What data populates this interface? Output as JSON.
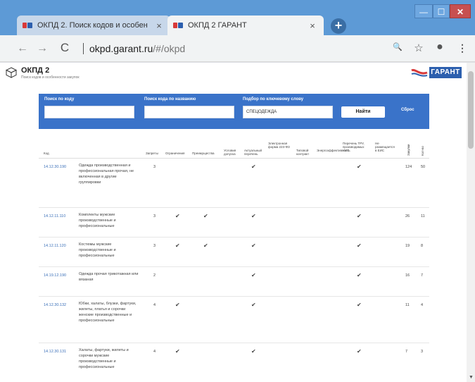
{
  "browser": {
    "tabs": [
      {
        "title": "ОКПД 2. Поиск кодов и особен",
        "close": "×"
      },
      {
        "title": "ОКПД 2 ГАРАНТ",
        "close": "×"
      }
    ],
    "new_tab": "+",
    "window_controls": {
      "minimize": "—",
      "maximize": "☐",
      "close": "✕"
    },
    "nav": {
      "back": "←",
      "forward": "→",
      "reload": "C"
    },
    "url_host": "okpd.garant.ru",
    "url_path": "/#/okpd",
    "toolbar_icons": {
      "zoom": "🔍",
      "star": "☆",
      "profile": "●",
      "menu": "⋮"
    }
  },
  "site": {
    "title": "ОКПД 2",
    "subtitle": "Поиск кодов и особенности закупок",
    "logo_text": "ГАРАНТ"
  },
  "search": {
    "code_label": "Поиск по коду",
    "code_value": "",
    "name_label": "Поиск кода по названию",
    "name_value": "",
    "keyword_label": "Подбор по ключевому слову",
    "keyword_value": "СПЕЦОДЕЖДА",
    "find_button": "Найти",
    "reset_link": "Сброс"
  },
  "table": {
    "headers": {
      "code": "Код",
      "zapr": "Запреты",
      "ogr": "Ограничения",
      "preim": "Преимущества",
      "usl": "Условия допуска",
      "akt": "Актуальный перечень",
      "el": "Электронная форма 223-ФЗ",
      "tip": "Типовой контракт",
      "energ": "Энергоэффективность",
      "tru": "Перечень ТРУ, производимых УИС",
      "nerazm": "Не размещается в ЕИС",
      "zakupki": "Закупки",
      "kod": "Кол-во"
    },
    "rows": [
      {
        "code": "14.12.30.190",
        "name": "Одежда производственная и профессиональная прочая, не включенная в другие группировки",
        "zapr": "3",
        "ogr": false,
        "preim": false,
        "akt": true,
        "tru": true,
        "n1": "124",
        "n2": "50"
      },
      {
        "code": "14.12.11.110",
        "name": "Комплекты мужские производственные и профессиональные",
        "zapr": "3",
        "ogr": true,
        "preim": true,
        "akt": true,
        "tru": true,
        "n1": "26",
        "n2": "11"
      },
      {
        "code": "14.12.11.120",
        "name": "Костюмы мужские производственные и профессиональные",
        "zapr": "3",
        "ogr": true,
        "preim": true,
        "akt": true,
        "tru": true,
        "n1": "19",
        "n2": "8"
      },
      {
        "code": "14.19.12.190",
        "name": "Одежда прочая трикотажная или вязаная",
        "zapr": "2",
        "ogr": false,
        "preim": false,
        "akt": true,
        "tru": true,
        "n1": "16",
        "n2": "7"
      },
      {
        "code": "14.12.30.132",
        "name": "Юбки, халаты, блузки, фартуки, жилеты, платья и сорочки женские производственные и профессиональные",
        "zapr": "4",
        "ogr": true,
        "preim": false,
        "akt": true,
        "tru": true,
        "n1": "11",
        "n2": "4"
      },
      {
        "code": "14.12.30.131",
        "name": "Халаты, фартуки, жилеты и сорочки мужские производственные и профессиональные",
        "zapr": "4",
        "ogr": true,
        "preim": false,
        "akt": true,
        "tru": true,
        "n1": "7",
        "n2": "3"
      }
    ],
    "check_glyph": "✔"
  },
  "colors": {
    "panel": "#3a73c9",
    "link": "#3a6fb8",
    "titlebar": "#5d9ad6"
  }
}
